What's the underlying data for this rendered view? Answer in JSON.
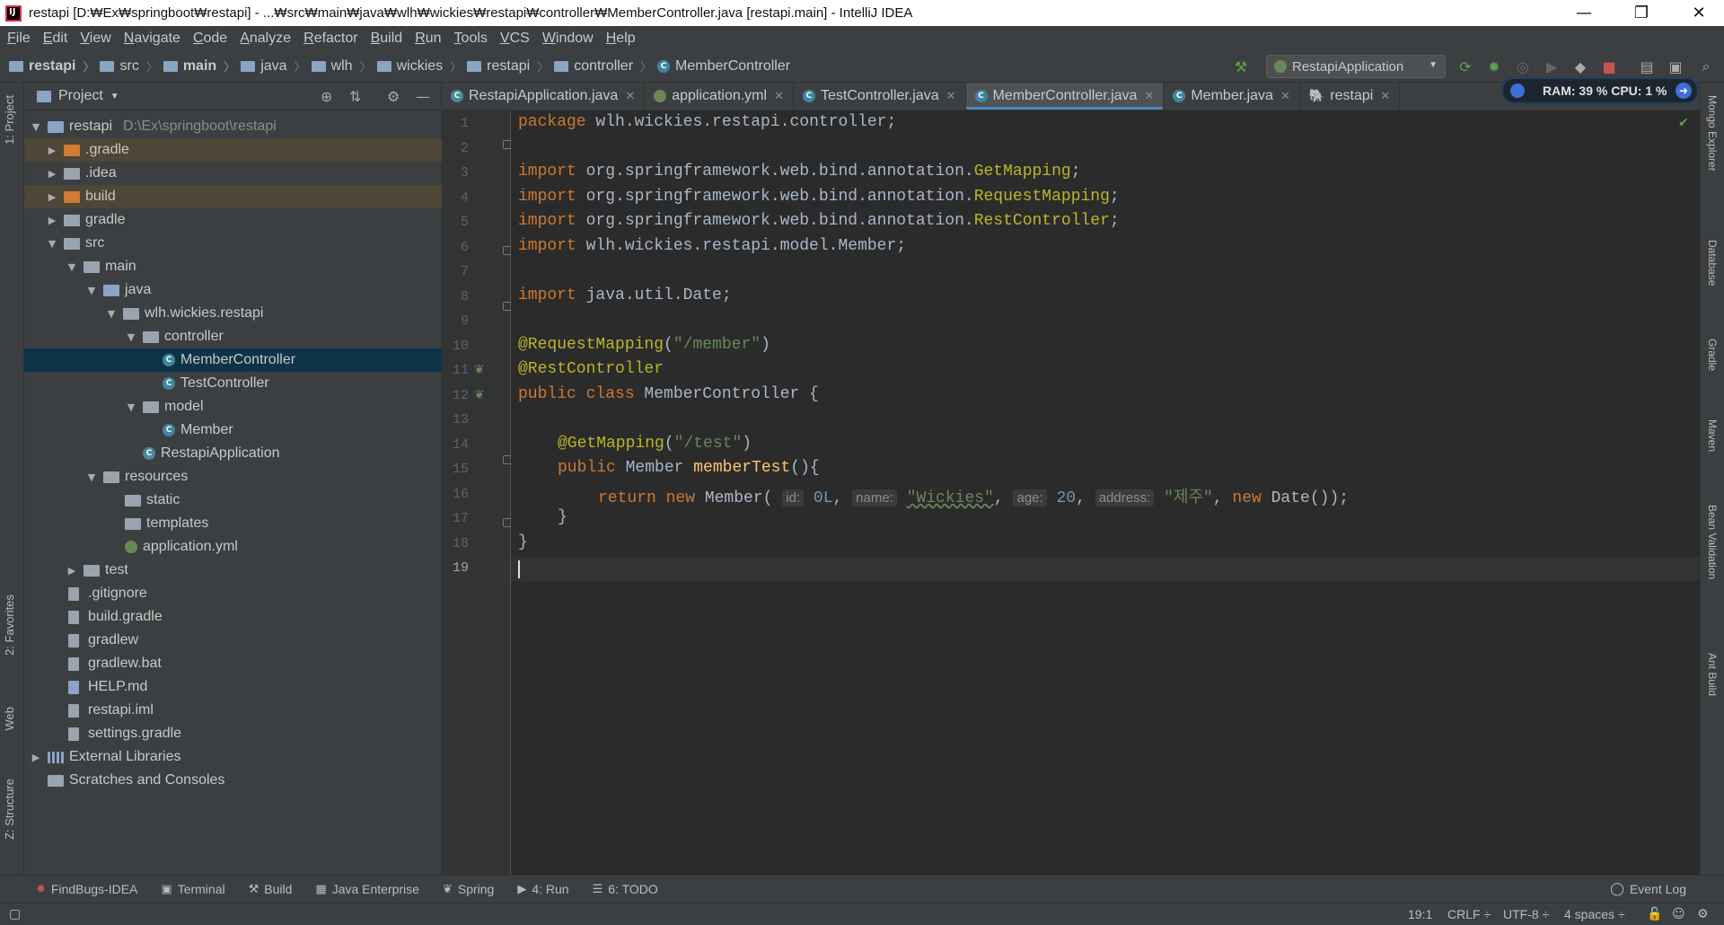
{
  "window": {
    "title": "restapi [D:₩Ex₩springboot₩restapi] - ...₩src₩main₩java₩wlh₩wickies₩restapi₩controller₩MemberController.java [restapi.main] - IntelliJ IDEA",
    "controls": [
      "—",
      "❐",
      "✕"
    ]
  },
  "menu": [
    "File",
    "Edit",
    "View",
    "Navigate",
    "Code",
    "Analyze",
    "Refactor",
    "Build",
    "Run",
    "Tools",
    "VCS",
    "Window",
    "Help"
  ],
  "breadcrumb": [
    "restapi",
    "src",
    "main",
    "java",
    "wlh",
    "wickies",
    "restapi",
    "controller",
    "MemberController"
  ],
  "toolbar": {
    "run_config": "RestapiApplication"
  },
  "left_strip": {
    "project_tab": "1: Project",
    "favorites_tab": "2: Favorites",
    "web_tab": "Web",
    "structure_tab": "Z: Structure"
  },
  "right_strip": [
    "Mongo Explorer",
    "Database",
    "Gradle",
    "Maven",
    "Bean Validation",
    "Ant Build"
  ],
  "project_panel": {
    "title": "Project",
    "root_name": "restapi",
    "root_path": "D:\\Ex\\springboot\\restapi",
    "items": [
      {
        "label": ".gradle"
      },
      {
        "label": ".idea"
      },
      {
        "label": "build"
      },
      {
        "label": "gradle"
      },
      {
        "label": "src"
      },
      {
        "label": "main"
      },
      {
        "label": "java"
      },
      {
        "label": "wlh.wickies.restapi"
      },
      {
        "label": "controller"
      },
      {
        "label": "MemberController"
      },
      {
        "label": "TestController"
      },
      {
        "label": "model"
      },
      {
        "label": "Member"
      },
      {
        "label": "RestapiApplication"
      },
      {
        "label": "resources"
      },
      {
        "label": "static"
      },
      {
        "label": "templates"
      },
      {
        "label": "application.yml"
      },
      {
        "label": "test"
      },
      {
        "label": ".gitignore"
      },
      {
        "label": "build.gradle"
      },
      {
        "label": "gradlew"
      },
      {
        "label": "gradlew.bat"
      },
      {
        "label": "HELP.md"
      },
      {
        "label": "restapi.iml"
      },
      {
        "label": "settings.gradle"
      },
      {
        "label": "External Libraries"
      },
      {
        "label": "Scratches and Consoles"
      }
    ]
  },
  "tabs": [
    {
      "label": "RestapiApplication.java"
    },
    {
      "label": "application.yml"
    },
    {
      "label": "TestController.java"
    },
    {
      "label": "MemberController.java",
      "active": true
    },
    {
      "label": "Member.java"
    },
    {
      "label": "restapi"
    }
  ],
  "memory_widget": "RAM: 39 %  CPU: 1 %",
  "editor": {
    "line_numbers": [
      "1",
      "2",
      "3",
      "4",
      "5",
      "6",
      "7",
      "8",
      "9",
      "10",
      "11",
      "12",
      "13",
      "14",
      "15",
      "16",
      "17",
      "18",
      "19"
    ],
    "current_line": "19",
    "code": {
      "l1_kw": "package",
      "l1_rest": " wlh.wickies.restapi.controller;",
      "import_kw": "import",
      "l3_pkg": " org.springframework.web.bind.annotation.",
      "l3_cls": "GetMapping",
      "l4_cls": "RequestMapping",
      "l5_cls": "RestController",
      "l6_rest": " wlh.wickies.restapi.model.Member;",
      "l8_rest": " java.util.Date;",
      "l10_ann": "@RequestMapping",
      "l10_str": "\"/member\"",
      "l11_ann": "@RestController",
      "l12_kw": "public class",
      "l12_rest": " MemberController {",
      "l14_ann": "@GetMapping",
      "l14_str": "\"/test\"",
      "l15_kw": "public",
      "l15_type": " Member ",
      "l15_fn": "memberTest",
      "l15_rest": "(){",
      "l16_kw1": "return new",
      "l16_type": " Member(",
      "hint_id": "id:",
      "val_id": "0L",
      "hint_name": "name:",
      "val_name": "\"Wickies\"",
      "hint_age": "age:",
      "val_age": "20",
      "hint_address": "address:",
      "val_address": "\"제주\"",
      "l16_kw2": "new",
      "l16_end": " Date());",
      "l17": "}",
      "l18": "}",
      "comma": ", ",
      "paren_open": "(",
      "paren_close": ")"
    }
  },
  "bottom_tools": [
    {
      "label": "FindBugs-IDEA",
      "icon": "bug-icon"
    },
    {
      "label": "Terminal",
      "icon": "terminal-icon"
    },
    {
      "label": "Build",
      "icon": "hammer-icon"
    },
    {
      "label": "Java Enterprise",
      "icon": "enterprise-icon"
    },
    {
      "label": "Spring",
      "icon": "spring-icon"
    },
    {
      "label": "4: Run",
      "icon": "run-icon"
    },
    {
      "label": "6: TODO",
      "icon": "todo-icon"
    }
  ],
  "event_log": "Event Log",
  "status": {
    "position": "19:1",
    "line_sep": "CRLF ÷",
    "encoding": "UTF-8 ÷",
    "indent": "4 spaces ÷"
  },
  "colors": {
    "keyword": "#cc7832",
    "annotation": "#bbb529",
    "string": "#6a8759",
    "number": "#6897bb",
    "function": "#ffc66d",
    "selection": "#0d3349",
    "accent": "#4a88c7"
  }
}
